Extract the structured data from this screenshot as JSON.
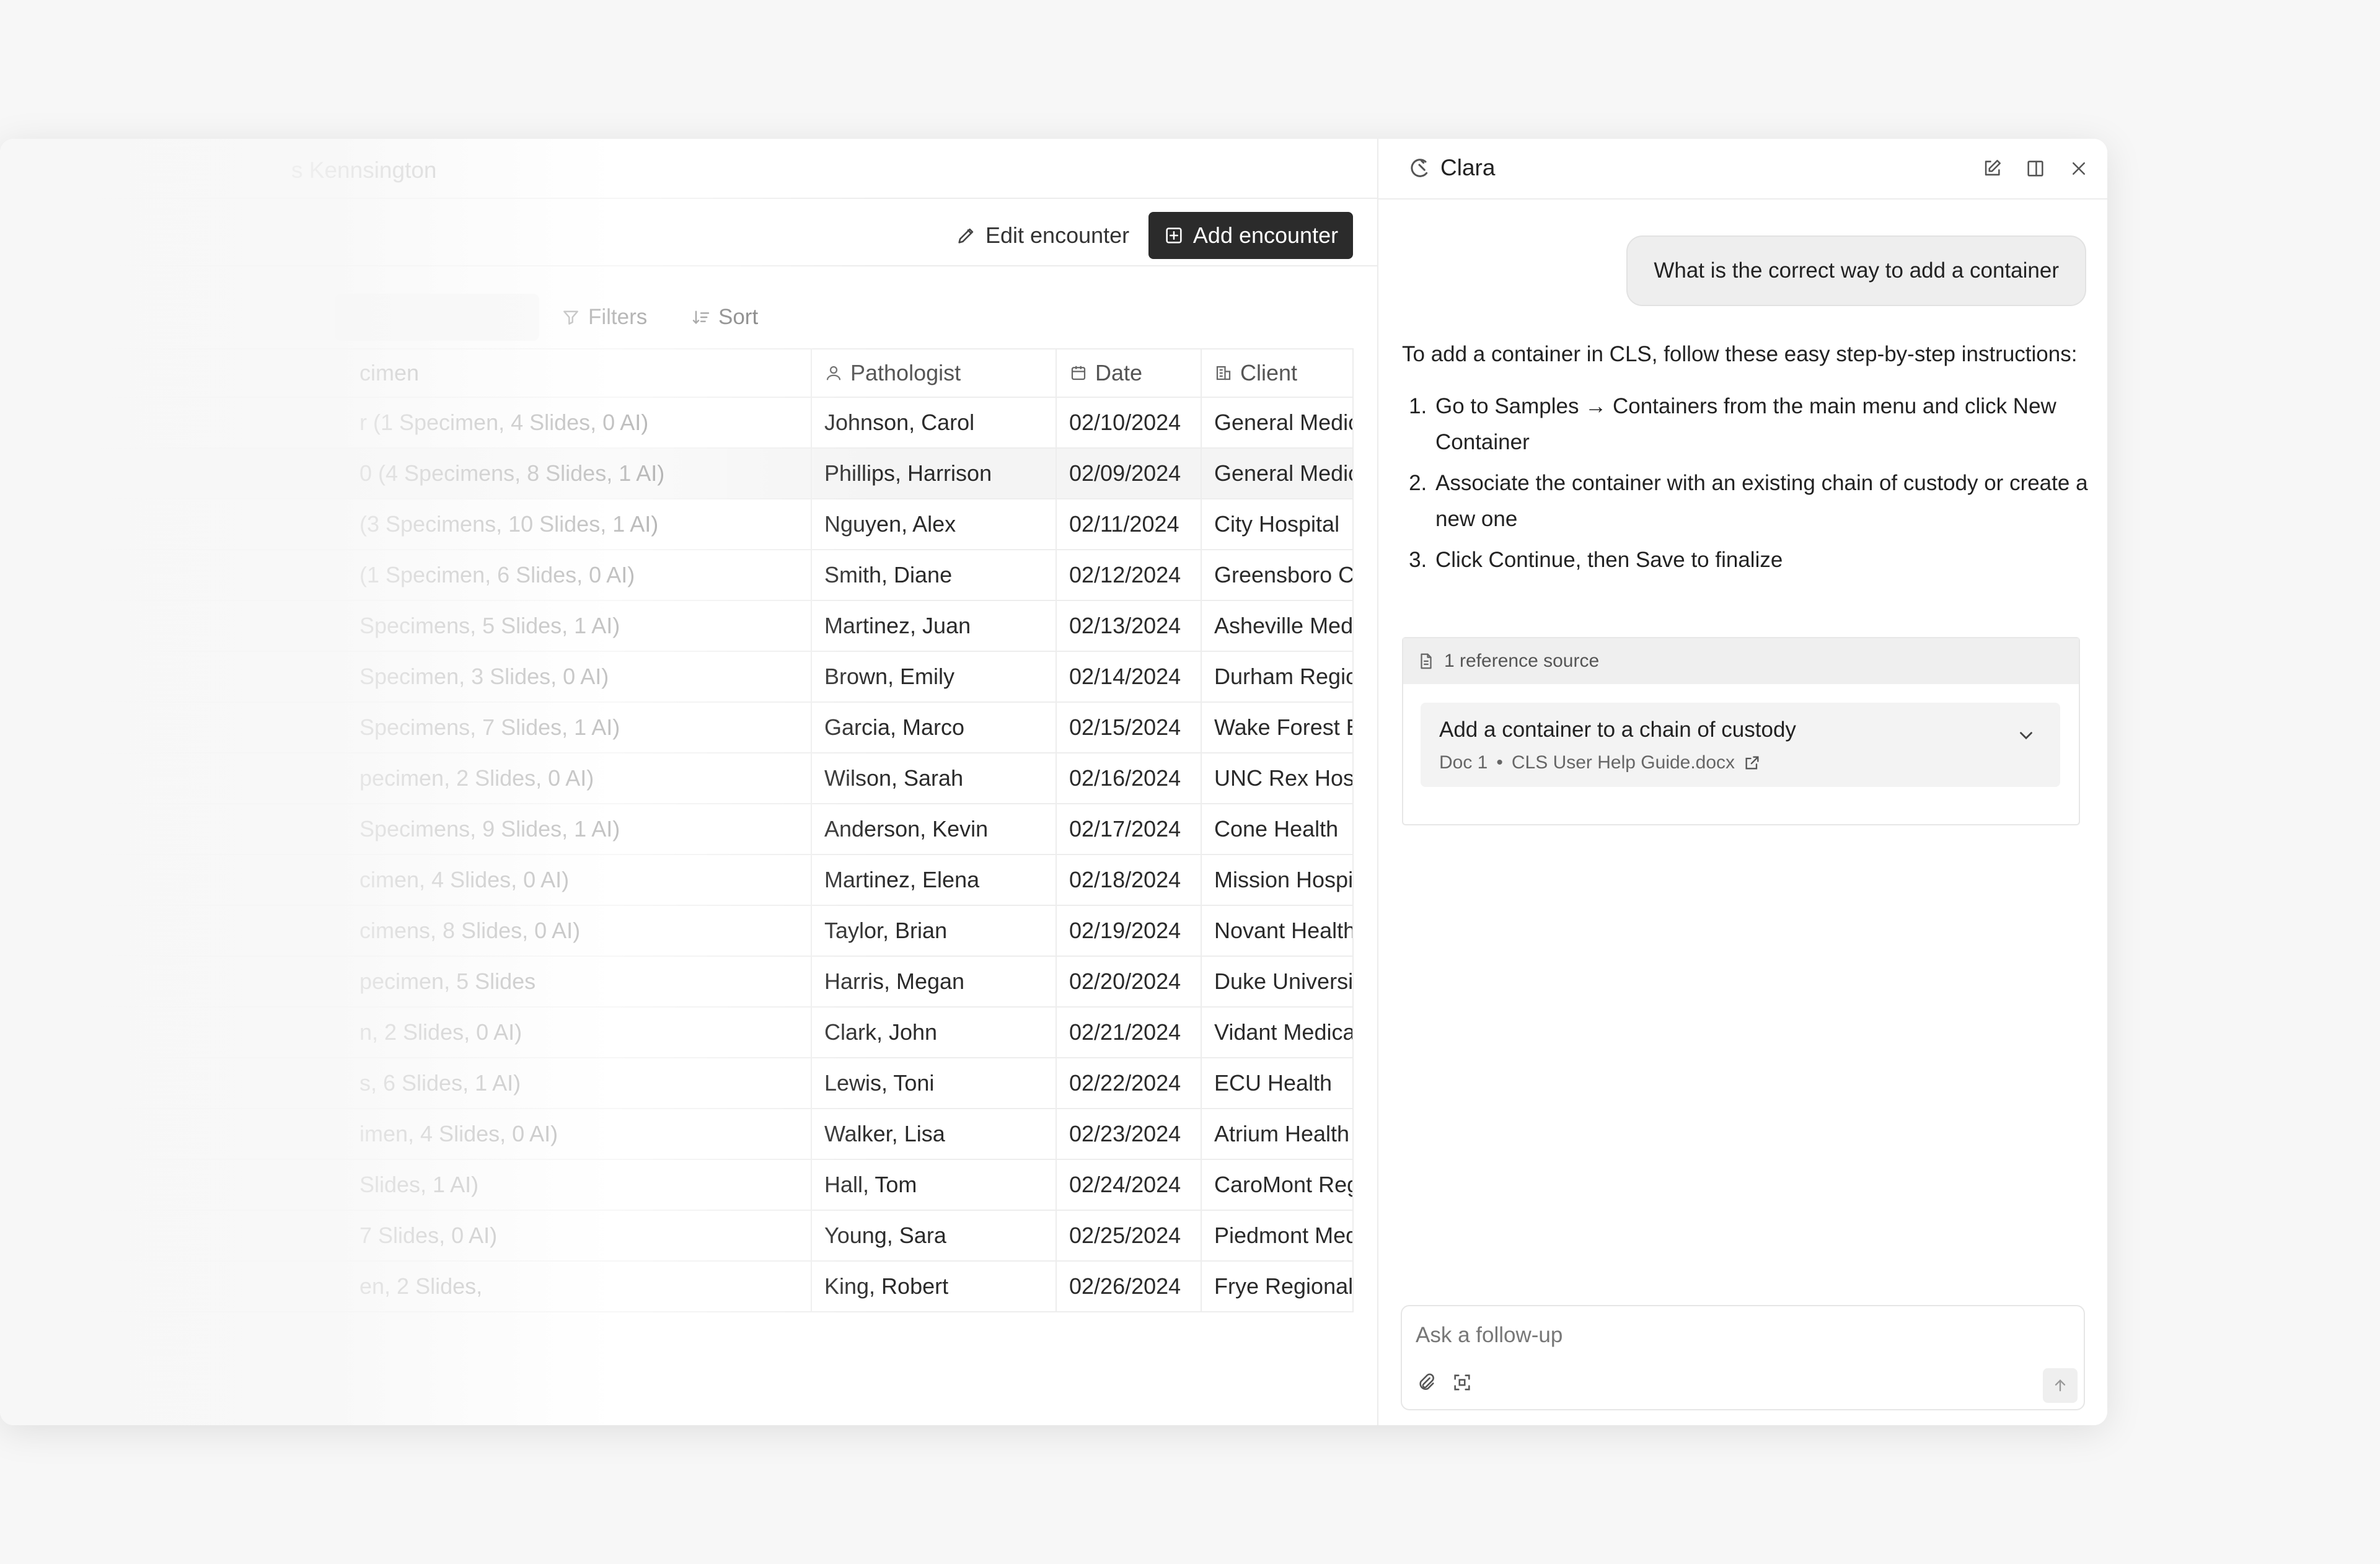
{
  "app": {
    "title": "s Kennsington",
    "subtitle": ""
  },
  "toolbar": {
    "edit_label": "Edit encounter",
    "add_label": "Add encounter",
    "filters_label": "Filters",
    "sort_label": "Sort"
  },
  "table": {
    "columns": {
      "specimen": "cimen",
      "pathologist": "Pathologist",
      "date": "Date",
      "client": "Client"
    },
    "rows": [
      {
        "specimen": "r (1 Specimen, 4 Slides, 0 AI)",
        "pathologist": "Johnson, Carol",
        "date": "02/10/2024",
        "client": "General Medical"
      },
      {
        "specimen": "0 (4 Specimens, 8 Slides, 1 AI)",
        "pathologist": "Phillips, Harrison",
        "date": "02/09/2024",
        "client": "General Medical"
      },
      {
        "specimen": "(3 Specimens, 10 Slides, 1 AI)",
        "pathologist": "Nguyen, Alex",
        "date": "02/11/2024",
        "client": "City Hospital"
      },
      {
        "specimen": "(1 Specimen, 6 Slides, 0 AI)",
        "pathologist": "Smith, Diane",
        "date": "02/12/2024",
        "client": "Greensboro C"
      },
      {
        "specimen": "Specimens, 5 Slides, 1 AI)",
        "pathologist": "Martinez, Juan",
        "date": "02/13/2024",
        "client": "Asheville Med"
      },
      {
        "specimen": "Specimen, 3 Slides, 0 AI)",
        "pathologist": "Brown, Emily",
        "date": "02/14/2024",
        "client": "Durham Regio"
      },
      {
        "specimen": "Specimens, 7 Slides, 1 AI)",
        "pathologist": "Garcia, Marco",
        "date": "02/15/2024",
        "client": "Wake Forest B"
      },
      {
        "specimen": "pecimen, 2 Slides, 0 AI)",
        "pathologist": "Wilson, Sarah",
        "date": "02/16/2024",
        "client": "UNC Rex Hos"
      },
      {
        "specimen": "Specimens, 9 Slides, 1 AI)",
        "pathologist": "Anderson, Kevin",
        "date": "02/17/2024",
        "client": "Cone Health"
      },
      {
        "specimen": "cimen, 4 Slides, 0 AI)",
        "pathologist": "Martinez, Elena",
        "date": "02/18/2024",
        "client": "Mission Hospi"
      },
      {
        "specimen": "cimens, 8 Slides, 0 AI)",
        "pathologist": "Taylor, Brian",
        "date": "02/19/2024",
        "client": "Novant Health"
      },
      {
        "specimen": "pecimen, 5 Slides",
        "pathologist": "Harris, Megan",
        "date": "02/20/2024",
        "client": "Duke Universi"
      },
      {
        "specimen": "n, 2 Slides, 0 AI)",
        "pathologist": "Clark, John",
        "date": "02/21/2024",
        "client": "Vidant Medica"
      },
      {
        "specimen": "s, 6 Slides, 1 AI)",
        "pathologist": "Lewis, Toni",
        "date": "02/22/2024",
        "client": "ECU Health"
      },
      {
        "specimen": "imen, 4 Slides, 0 AI)",
        "pathologist": "Walker, Lisa",
        "date": "02/23/2024",
        "client": "Atrium Health"
      },
      {
        "specimen": "Slides, 1 AI)",
        "pathologist": "Hall, Tom",
        "date": "02/24/2024",
        "client": "CaroMont Reg"
      },
      {
        "specimen": "7 Slides, 0 AI)",
        "pathologist": "Young, Sara",
        "date": "02/25/2024",
        "client": "Piedmont Med"
      },
      {
        "specimen": "en, 2 Slides,",
        "pathologist": "King, Robert",
        "date": "02/26/2024",
        "client": "Frye Regional"
      }
    ]
  },
  "chat": {
    "title": "Clara",
    "user_message": "What is the correct way to add a container",
    "intro": "To add a container in CLS, follow these easy step-by-step instructions:",
    "steps": [
      "Go to Samples → Containers from the main menu and click New Container",
      "Associate the container with an existing chain of custody or create a new one",
      "Click Continue, then Save to finalize"
    ],
    "reference": {
      "header": "1 reference source",
      "title": "Add a container to a chain of custody",
      "doc": "Doc 1",
      "file": "CLS User Help Guide.docx"
    },
    "composer_placeholder": "Ask a follow-up"
  },
  "colors": {
    "primary_button": "#2b2b2b",
    "highlight_row": "#f4f4f4"
  }
}
